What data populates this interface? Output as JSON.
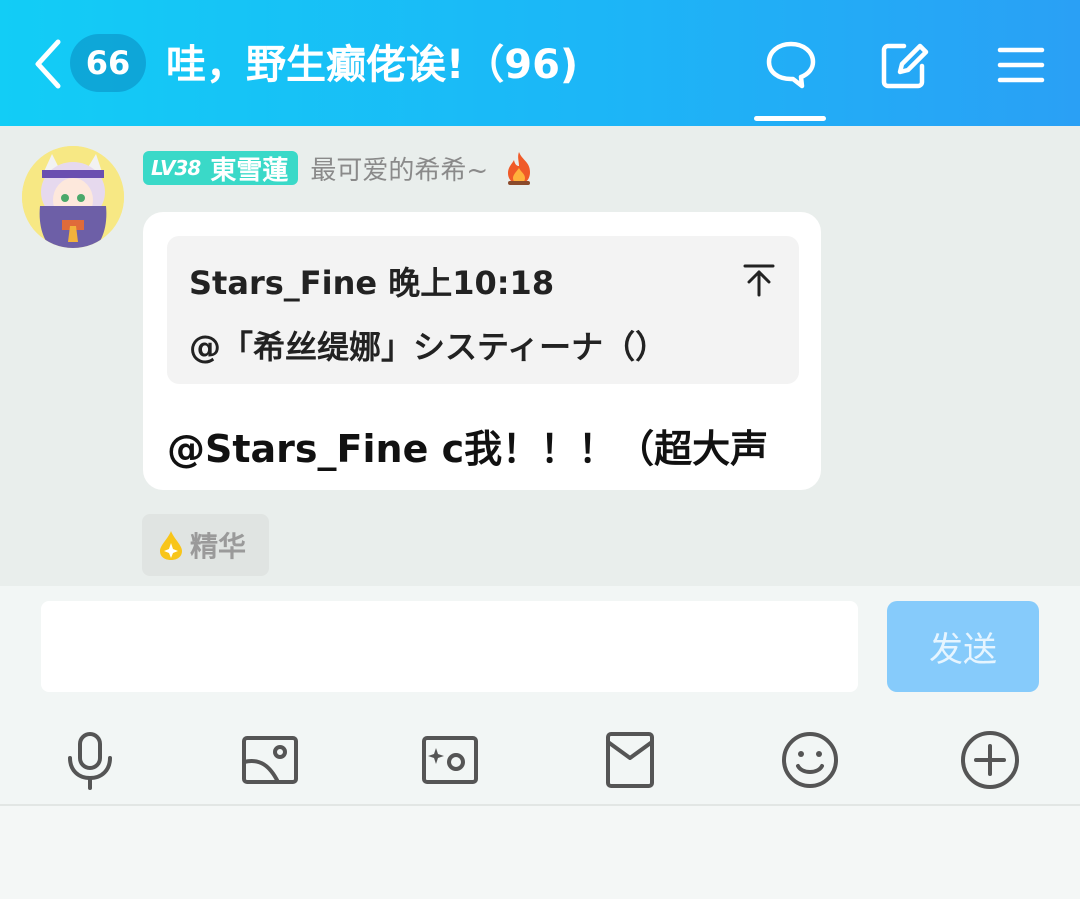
{
  "header": {
    "unread_count": "66",
    "title": "哇，野生癫佬诶!（96)",
    "icons": [
      "back-arrow-icon",
      "chat-bubble-icon",
      "edit-icon",
      "menu-icon"
    ]
  },
  "message": {
    "level": "LV38",
    "sender": "東雪蓮",
    "sender_title": "最可爱的希希~",
    "quote_header": "Stars_Fine 晚上10:18",
    "quote_text": "@「希丝缇娜」システィーナ（）",
    "text": "@Stars_Fine c我！！！（超大声",
    "essence_label": "精华"
  },
  "input": {
    "placeholder": "",
    "send_label": "发送"
  },
  "toolbar": [
    "microphone-icon",
    "image-icon",
    "camera-icon",
    "red-packet-icon",
    "emoji-icon",
    "plus-icon"
  ],
  "colors": {
    "header_start": "#12cdf6",
    "header_end": "#2aa0f5",
    "level_tag": "#3ad9c8",
    "send_button": "#86cbfb"
  }
}
